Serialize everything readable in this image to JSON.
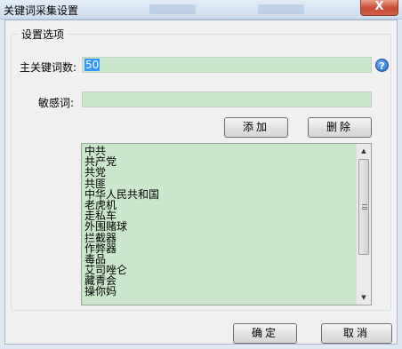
{
  "window": {
    "title": "关键词采集设置",
    "close_label": "X"
  },
  "group": {
    "legend": "设置选项"
  },
  "form": {
    "main_keyword_label": "主关键词数:",
    "main_keyword_value": "50",
    "sensitive_label": "敏感词:",
    "sensitive_value": ""
  },
  "buttons": {
    "add": "添加",
    "delete": "删除",
    "ok": "确定",
    "cancel": "取消"
  },
  "help_icon": "help-icon",
  "sensitive_words": [
    "中共",
    "共产党",
    "共党",
    "共匪",
    "中华人民共和国",
    "老虎机",
    "走私车",
    "外围赌球",
    "拦截器",
    "作弊器",
    "毒品",
    "艾司唑仑",
    "藏青会",
    "操你妈"
  ],
  "colors": {
    "input_bg": "#cbe7cb",
    "selection": "#3399ff"
  }
}
